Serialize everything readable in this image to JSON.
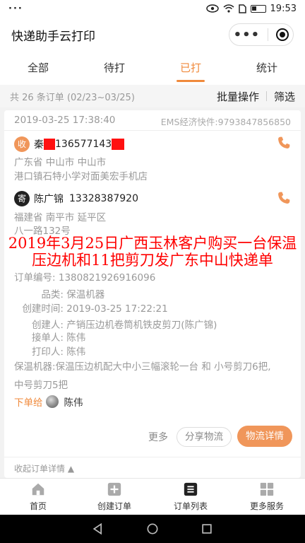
{
  "status_bar": {
    "left": "···",
    "time": "19:53"
  },
  "app": {
    "title": "快递助手云打印"
  },
  "tabs": [
    {
      "label": "全部"
    },
    {
      "label": "待打"
    },
    {
      "label": "已打"
    },
    {
      "label": "统计"
    }
  ],
  "summary": {
    "count": "共 26 条订单 (02/23~03/25)",
    "batch": "批量操作",
    "filter": "筛选"
  },
  "order": {
    "time": "2019-03-25 17:38:40",
    "express": "EMS经济快件:9793847856850",
    "receiver": {
      "badge": "收",
      "surname": "秦",
      "phone": "136577143",
      "address1": "广东省 中山市 中山市",
      "address2": "港口镇石特小学对面美宏手机店"
    },
    "sender": {
      "badge": "寄",
      "name": "陈广锦",
      "phone": "13328387920",
      "address1": "福建省 南平市 延平区",
      "address2": "八一路132号"
    },
    "overlay_line1": "2019年3月25日广西玉林客户购买一台保温",
    "overlay_line2": "压边机和11把剪刀发广东中山快递单",
    "order_no_label": "订单编号:",
    "order_no": "1380821926916096",
    "category_label": "品类:",
    "category": "保温机器",
    "created_label": "创建时间:",
    "created": "2019-03-25 17:22:21",
    "creator_label": "创建人:",
    "creator": "产销压边机卷筒机铁皮剪刀(陈广锦)",
    "receiver_person_label": "接单人:",
    "receiver_person": "陈伟",
    "printer_label": "打印人:",
    "printer": "陈伟",
    "description_line1": "保温机器:保温压边机配大中小三幅滚轮一台 和 小号剪刀6把,",
    "description_line2": "中号剪刀5把",
    "assigned_label": "下单给",
    "assigned_name": "陈伟",
    "more": "更多",
    "share": "分享物流",
    "detail": "物流详情",
    "collapse": "收起订单详情 ▲"
  },
  "nav": [
    {
      "label": "首页"
    },
    {
      "label": "创建订单"
    },
    {
      "label": "订单列表"
    },
    {
      "label": "更多服务"
    }
  ],
  "colors": {
    "accent": "#f08a3c",
    "overlay": "#ff0000",
    "redaction": "#ff1010"
  }
}
